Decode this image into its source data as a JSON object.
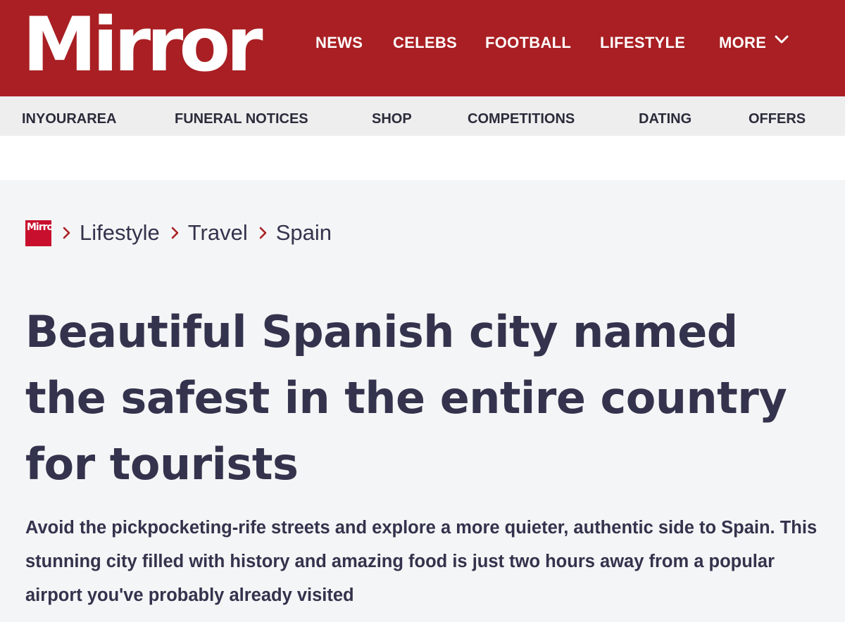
{
  "header": {
    "logo_text": "Mirror",
    "primary_nav": [
      "NEWS",
      "CELEBS",
      "FOOTBALL",
      "LIFESTYLE"
    ],
    "more_label": "MORE",
    "secondary_nav": [
      "INYOURAREA",
      "FUNERAL NOTICES",
      "SHOP",
      "COMPETITIONS",
      "DATING",
      "OFFERS"
    ]
  },
  "breadcrumb": {
    "logo_text": "Mirror",
    "items": [
      "Lifestyle",
      "Travel",
      "Spain"
    ]
  },
  "article": {
    "headline": "Beautiful Spanish city named the safest in the entire country for tourists",
    "standfirst": "Avoid the pickpocketing-rife streets and explore a more quieter, authentic side to Spain. This stunning city filled with history and amazing food is just two hours away from a popular airport you've probably already visited"
  },
  "colors": {
    "brand_red": "#a91f23",
    "secondary_nav_bg": "#eeeeef",
    "text_dark": "#33334d",
    "page_bg": "#f4f5f6"
  },
  "icons": {
    "more": "chevron-down-icon",
    "breadcrumb_separator": "chevron-right-icon"
  }
}
